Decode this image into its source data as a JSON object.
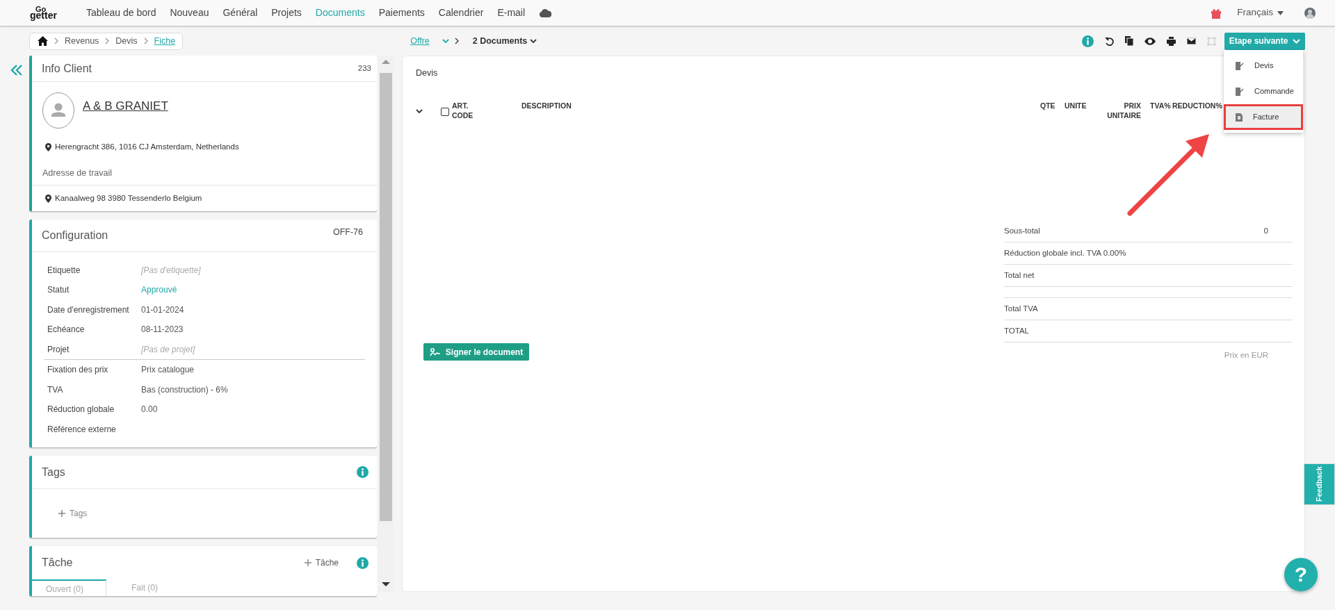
{
  "navbar": {
    "logo_top": "Go",
    "logo_bottom": "getter",
    "items": [
      {
        "label": "Tableau de bord",
        "selected": false
      },
      {
        "label": "Nouveau",
        "selected": false
      },
      {
        "label": "Général",
        "selected": false
      },
      {
        "label": "Projets",
        "selected": false
      },
      {
        "label": "Documents",
        "selected": true
      },
      {
        "label": "Paiements",
        "selected": false
      },
      {
        "label": "Calendrier",
        "selected": false
      },
      {
        "label": "E-mail",
        "selected": false
      }
    ],
    "language": "Français"
  },
  "breadcrumb": [
    {
      "label": "Revenus",
      "current": false
    },
    {
      "label": "Devis",
      "current": false
    },
    {
      "label": "Fiche",
      "current": true
    }
  ],
  "document_switch": {
    "type_link": "Offre",
    "documents": "2 Documents"
  },
  "toolbar_icons": [
    {
      "kind": "info",
      "disabled": false
    },
    {
      "kind": "undo",
      "disabled": false
    },
    {
      "kind": "copy",
      "disabled": false
    },
    {
      "kind": "eye",
      "disabled": false
    },
    {
      "kind": "print",
      "disabled": false
    },
    {
      "kind": "mail",
      "disabled": false
    },
    {
      "kind": "frame",
      "disabled": true
    }
  ],
  "next_step": {
    "button": "Etape suivante",
    "items": [
      {
        "label": "Devis",
        "kind": "edit",
        "selected": false
      },
      {
        "label": "Commande",
        "kind": "edit",
        "selected": false
      },
      {
        "label": "Facture",
        "kind": "invoice",
        "selected": true
      }
    ]
  },
  "client_card": {
    "title": "Info Client",
    "count": "233",
    "name": "A & B GRANIET",
    "address": "Herengracht 386, 1016 CJ Amsterdam, Netherlands",
    "work_address_label": "Adresse de travail",
    "work_address": "Kanaalweg 98 3980 Tessenderlo Belgium"
  },
  "configuration": {
    "title": "Configuration",
    "reference": "OFF-76",
    "field_groups": [
      [
        {
          "label": "Etiquette",
          "value": "[Pas d'etiquette]",
          "kind": "empty"
        },
        {
          "label": "Statut",
          "value": "Approuvé",
          "kind": "status"
        },
        {
          "label": "Date d'enregistrement",
          "value": "01-01-2024",
          "kind": "plain"
        },
        {
          "label": "Echéance",
          "value": "08-11-2023",
          "kind": "plain"
        },
        {
          "label": "Projet",
          "value": "[Pas de projet]",
          "kind": "empty"
        }
      ],
      [
        {
          "label": "Fixation des prix",
          "value": "Prix catalogue",
          "kind": "plain"
        },
        {
          "label": "TVA",
          "value": "Bas (construction) - 6%",
          "kind": "plain"
        },
        {
          "label": "Réduction globale",
          "value": "0.00",
          "kind": "plain"
        },
        {
          "label": "Référence externe"
        }
      ]
    ]
  },
  "tags": {
    "title": "Tags",
    "add_label": "Tags"
  },
  "task": {
    "title": "Tâche",
    "add_label": "Tâche",
    "tabs": [
      {
        "label": "Ouvert (0)",
        "selected": true
      },
      {
        "label": "Fait (0)",
        "selected": false
      }
    ]
  },
  "document": {
    "title": "Devis",
    "select_all_checked": false,
    "columns": [
      "ART. CODE",
      "DESCRIPTION",
      "QTE",
      "UNITE",
      "PRIX UNITAIRE",
      "TVA%",
      "REDUCTION%"
    ],
    "totals": [
      {
        "kind": "row",
        "label": "Sous-total",
        "value": "0"
      },
      {
        "kind": "row",
        "label": "Réduction globale incl. TVA 0.00%"
      },
      {
        "kind": "row",
        "label": "Total net"
      },
      {
        "kind": "spacer"
      },
      {
        "kind": "row",
        "label": "Total TVA"
      },
      {
        "kind": "row",
        "label": "TOTAL"
      }
    ],
    "currency_note": "Prix en EUR",
    "sign_button": "Signer le document"
  },
  "feedback_tab": "Feedback",
  "help_button": "?"
}
